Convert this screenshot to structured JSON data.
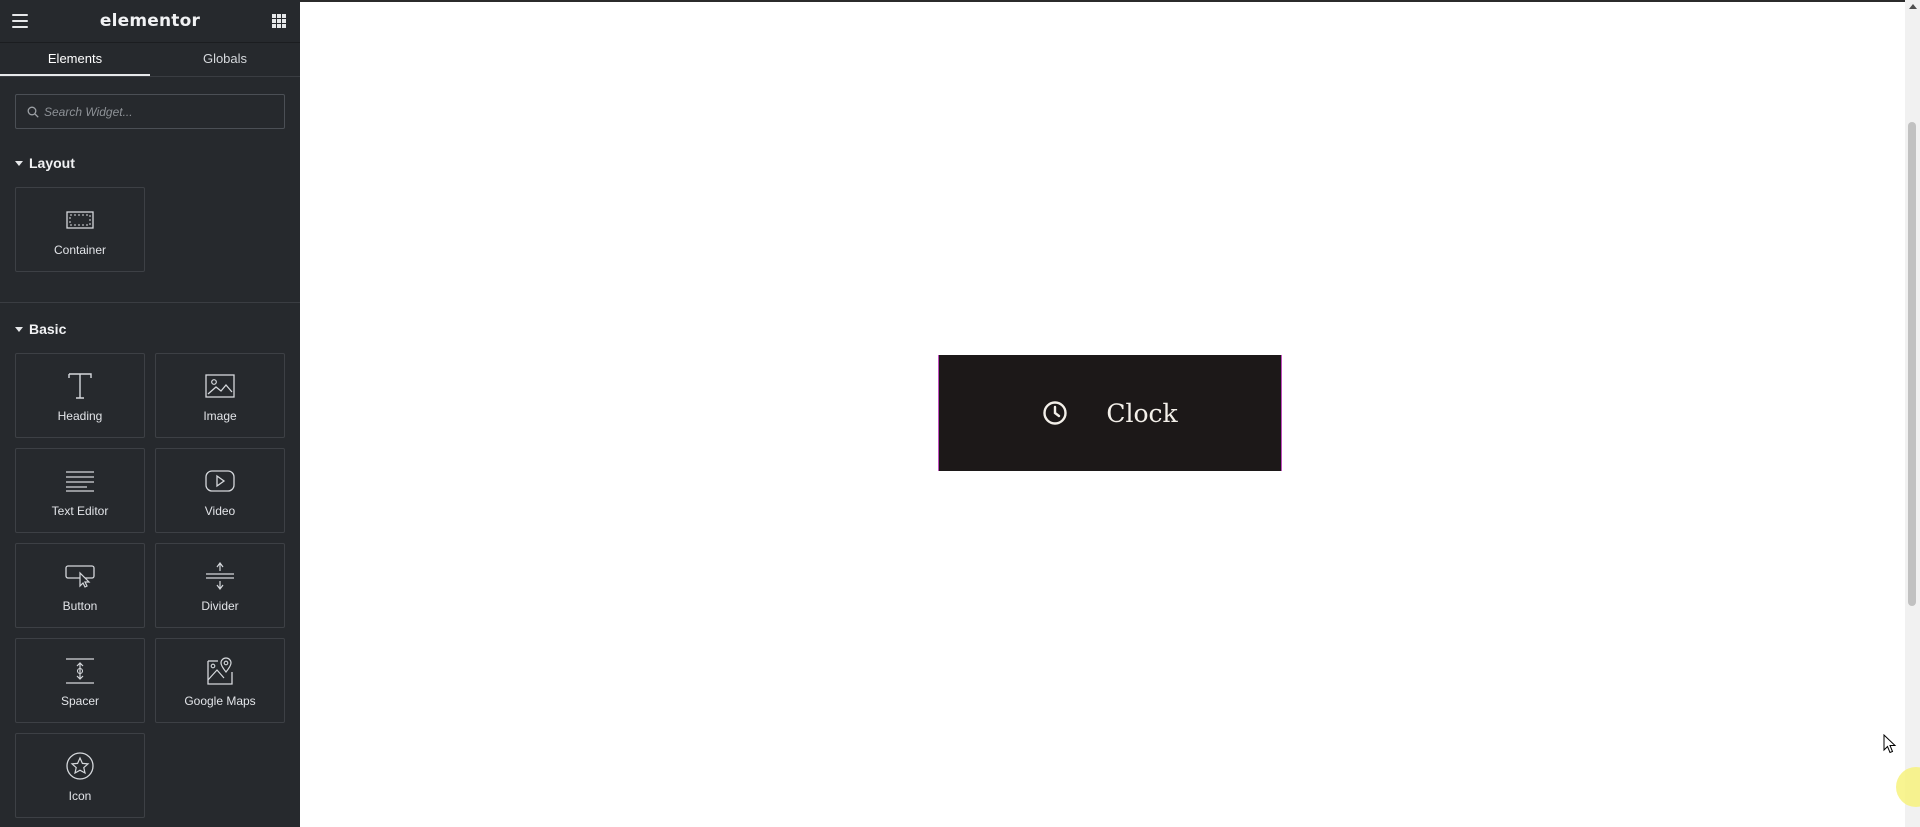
{
  "app": {
    "logo": "elementor"
  },
  "tabs": [
    {
      "label": "Elements",
      "active": true
    },
    {
      "label": "Globals",
      "active": false
    }
  ],
  "search": {
    "placeholder": "Search Widget...",
    "value": ""
  },
  "sections": {
    "layout": {
      "title": "Layout",
      "widgets": [
        {
          "label": "Container",
          "icon": "container-icon"
        }
      ]
    },
    "basic": {
      "title": "Basic",
      "widgets": [
        {
          "label": "Heading",
          "icon": "heading-icon"
        },
        {
          "label": "Image",
          "icon": "image-icon"
        },
        {
          "label": "Text Editor",
          "icon": "text-editor-icon"
        },
        {
          "label": "Video",
          "icon": "video-icon"
        },
        {
          "label": "Button",
          "icon": "button-icon"
        },
        {
          "label": "Divider",
          "icon": "divider-icon"
        },
        {
          "label": "Spacer",
          "icon": "spacer-icon"
        },
        {
          "label": "Google Maps",
          "icon": "google-maps-icon"
        },
        {
          "label": "Icon",
          "icon": "star-icon"
        }
      ]
    }
  },
  "canvas": {
    "clock_button": {
      "label": "Clock",
      "icon": "clock-icon"
    }
  },
  "colors": {
    "sidebar_bg": "#26292d",
    "clock_bg": "#1c1818",
    "clock_text": "#f3efe9",
    "selection_outline": "#c24fbf"
  }
}
